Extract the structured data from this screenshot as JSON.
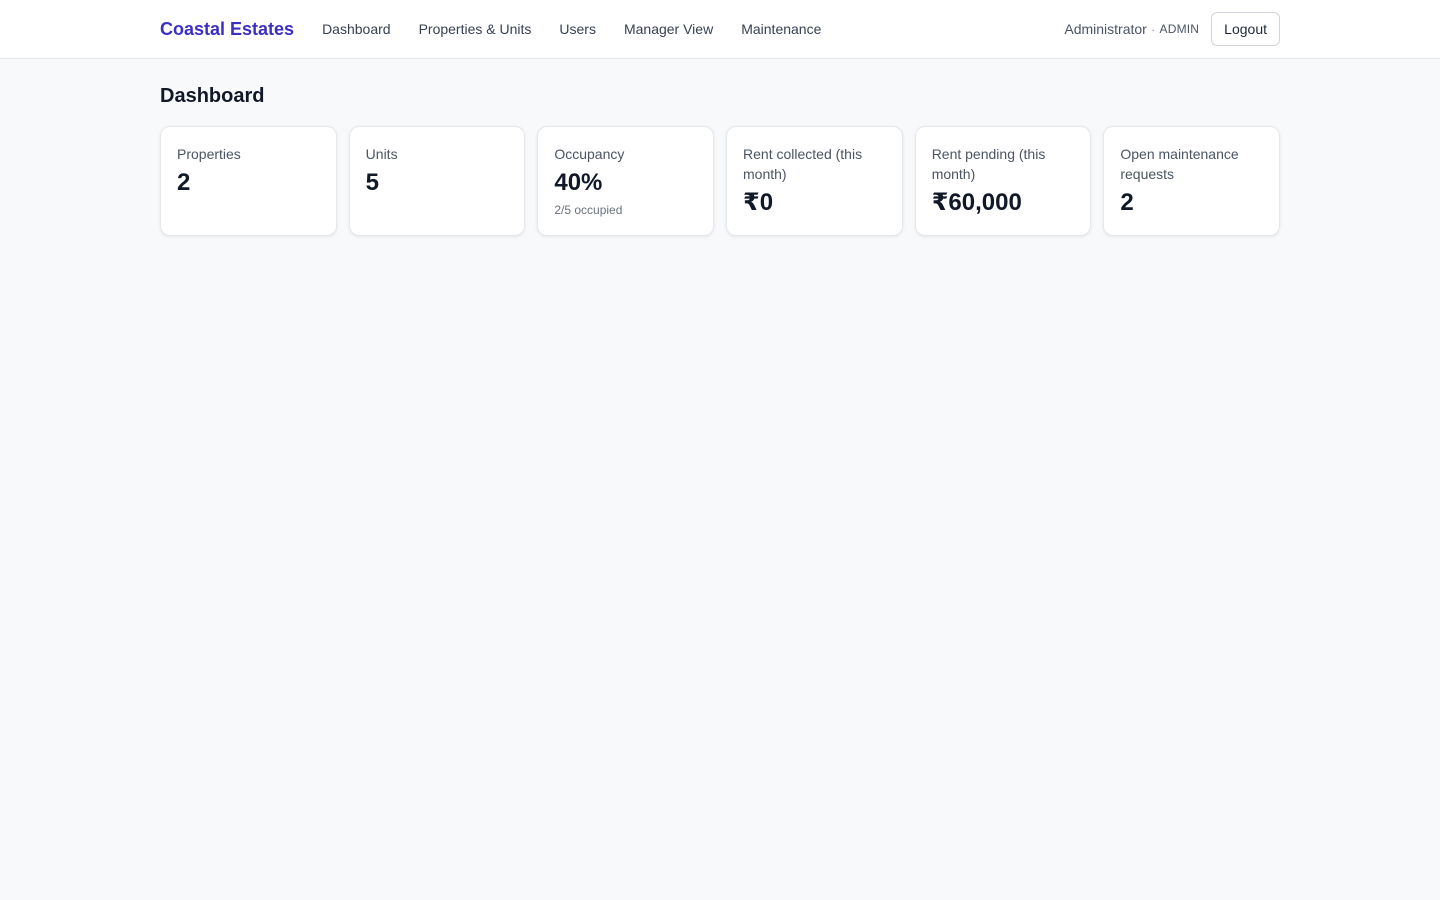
{
  "header": {
    "brand": "Coastal Estates",
    "nav": [
      {
        "label": "Dashboard"
      },
      {
        "label": "Properties & Units"
      },
      {
        "label": "Users"
      },
      {
        "label": "Manager View"
      },
      {
        "label": "Maintenance"
      }
    ],
    "user_name": "Administrator",
    "separator": "·",
    "user_role": "ADMIN",
    "logout_label": "Logout"
  },
  "main": {
    "title": "Dashboard",
    "cards": [
      {
        "label": "Properties",
        "value": "2"
      },
      {
        "label": "Units",
        "value": "5"
      },
      {
        "label": "Occupancy",
        "value": "40%",
        "sub": "2/5 occupied"
      },
      {
        "label": "Rent collected (this month)",
        "value": "₹0"
      },
      {
        "label": "Rent pending (this month)",
        "value": "₹60,000"
      },
      {
        "label": "Open maintenance requests",
        "value": "2"
      }
    ]
  },
  "colors": {
    "brand": "#3b2fc4",
    "background": "#f8f9fb",
    "card": "#ffffff",
    "text": "#111827",
    "muted": "#4b5563"
  }
}
